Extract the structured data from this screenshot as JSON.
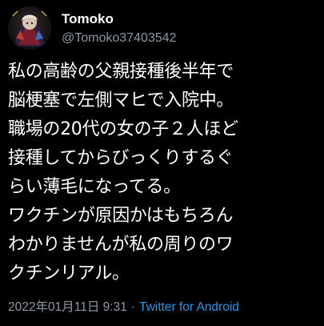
{
  "author": {
    "display_name": "Tomoko",
    "handle": "@Tomoko37403542",
    "avatar_icon": "profile-avatar-image"
  },
  "tweet": {
    "lines": [
      "私の高齢の父親接種後半年で",
      "脳梗塞で左側マヒで入院中。",
      "職場の20代の女の子２人ほど",
      "接種してからびっくりするぐ",
      "らい薄毛になってる。",
      "ワクチンが原因かはもちろん",
      "わかりませんが私の周りのワ",
      "クチンリアル。"
    ]
  },
  "meta": {
    "datetime": "2022年01月11日 9:31",
    "separator": "·",
    "source": "Twitter for Android"
  },
  "colors": {
    "background": "#000000",
    "text": "#ffffff",
    "secondary": "#8b98a5",
    "accent": "#1d9bf0"
  }
}
